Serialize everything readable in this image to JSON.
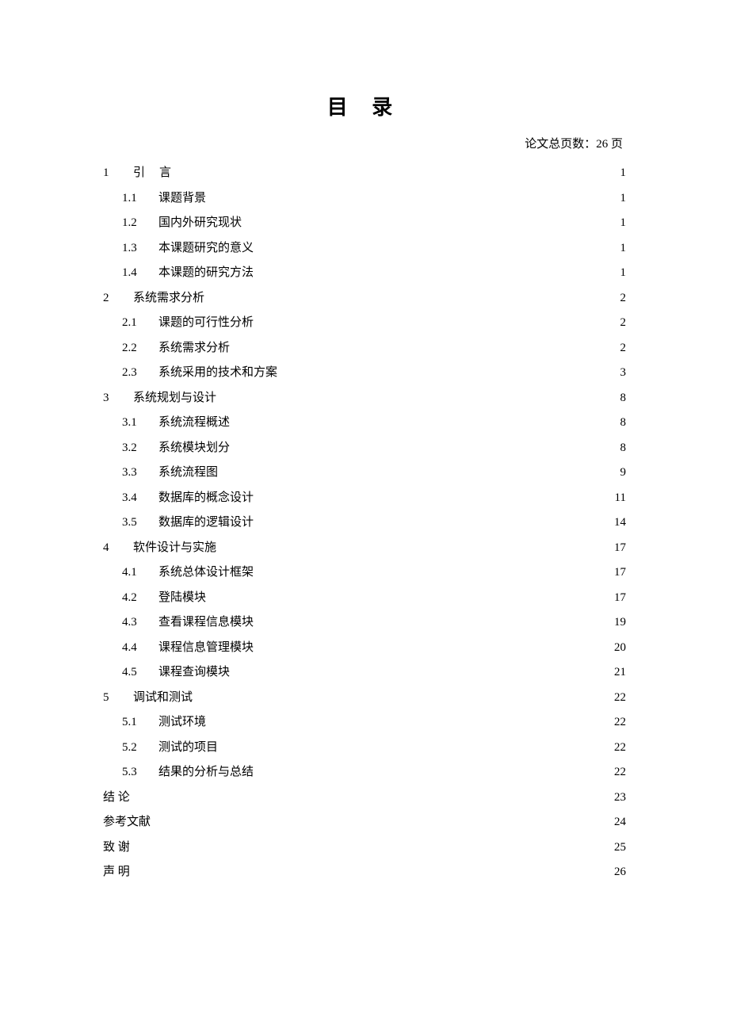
{
  "title": "目 录",
  "page_count_label": "论文总页数：26 页",
  "toc": [
    {
      "level": 1,
      "num": "1",
      "label": "引言",
      "page": "1",
      "spaced": true
    },
    {
      "level": 2,
      "num": "1.1",
      "label": "课题背景",
      "page": "1"
    },
    {
      "level": 2,
      "num": "1.2",
      "label": "国内外研究现状",
      "page": "1"
    },
    {
      "level": 2,
      "num": "1.3",
      "label": "本课题研究的意义",
      "page": "1"
    },
    {
      "level": 2,
      "num": "1.4",
      "label": "本课题的研究方法",
      "page": "1"
    },
    {
      "level": 1,
      "num": "2",
      "label": "系统需求分析",
      "page": "2"
    },
    {
      "level": 2,
      "num": "2.1",
      "label": "课题的可行性分析",
      "page": "2"
    },
    {
      "level": 2,
      "num": "2.2",
      "label": "系统需求分析",
      "page": "2"
    },
    {
      "level": 2,
      "num": "2.3",
      "label": "系统采用的技术和方案",
      "page": "3"
    },
    {
      "level": 1,
      "num": "3",
      "label": "系统规划与设计",
      "page": "8"
    },
    {
      "level": 2,
      "num": "3.1",
      "label": "系统流程概述",
      "page": "8"
    },
    {
      "level": 2,
      "num": "3.2",
      "label": "系统模块划分",
      "page": "8"
    },
    {
      "level": 2,
      "num": "3.3",
      "label": "系统流程图",
      "page": "9"
    },
    {
      "level": 2,
      "num": "3.4",
      "label": "数据库的概念设计",
      "page": "11"
    },
    {
      "level": 2,
      "num": "3.5",
      "label": "数据库的逻辑设计",
      "page": "14"
    },
    {
      "level": 1,
      "num": "4",
      "label": "软件设计与实施",
      "page": "17"
    },
    {
      "level": 2,
      "num": "4.1",
      "label": "系统总体设计框架",
      "page": "17"
    },
    {
      "level": 2,
      "num": "4.2",
      "label": "登陆模块",
      "page": "17"
    },
    {
      "level": 2,
      "num": "4.3",
      "label": "查看课程信息模块",
      "page": "19"
    },
    {
      "level": 2,
      "num": "4.4",
      "label": "课程信息管理模块",
      "page": "20"
    },
    {
      "level": 2,
      "num": "4.5",
      "label": "课程查询模块",
      "page": "21"
    },
    {
      "level": 1,
      "num": "5",
      "label": "调试和测试",
      "page": "22"
    },
    {
      "level": 2,
      "num": "5.1",
      "label": "测试环境",
      "page": "22"
    },
    {
      "level": 2,
      "num": "5.2",
      "label": "测试的项目",
      "page": "22"
    },
    {
      "level": 2,
      "num": "5.3",
      "label": "结果的分析与总结",
      "page": "22"
    },
    {
      "level": 1,
      "num": "",
      "label": "结    论",
      "page": "23"
    },
    {
      "level": 1,
      "num": "",
      "label": "参考文献",
      "page": "24"
    },
    {
      "level": 1,
      "num": "",
      "label": "致    谢",
      "page": "25"
    },
    {
      "level": 1,
      "num": "",
      "label": "声    明",
      "page": "26"
    }
  ]
}
